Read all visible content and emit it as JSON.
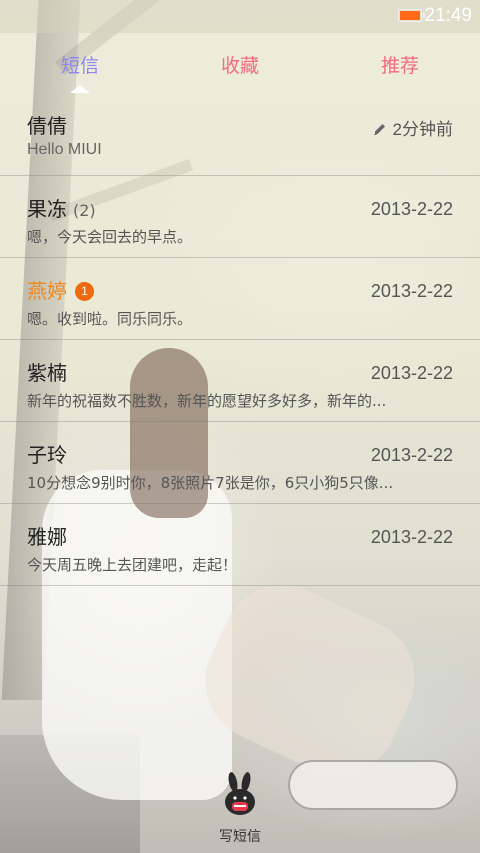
{
  "status_bar": {
    "time": "21:49",
    "battery_color": "#ff6a1a"
  },
  "tabs": [
    {
      "label": "短信",
      "selected": true,
      "color": "#8b86f0"
    },
    {
      "label": "收藏",
      "selected": false,
      "color": "#f46a7e"
    },
    {
      "label": "推荐",
      "selected": false,
      "color": "#f46a7e"
    }
  ],
  "threads": [
    {
      "name": "倩倩",
      "preview": "Hello MIUI",
      "time": "2分钟前",
      "icon": "pencil-icon",
      "count": "",
      "unread_badge": ""
    },
    {
      "name": "果冻",
      "count": "(2)",
      "preview": "嗯，今天会回去的早点。",
      "time": "2013-2-22",
      "unread_badge": ""
    },
    {
      "name": "燕婷",
      "count": "",
      "unread_badge": "1",
      "preview": "嗯。收到啦。同乐同乐。",
      "time": "2013-2-22"
    },
    {
      "name": "紫楠",
      "count": "",
      "unread_badge": "",
      "preview": "新年的祝福数不胜数，新年的愿望好多好多，新年的...",
      "time": "2013-2-22"
    },
    {
      "name": "子玲",
      "count": "",
      "unread_badge": "",
      "preview": "10分想念9别时你，8张照片7张是你，6只小狗5只像...",
      "time": "2013-2-22"
    },
    {
      "name": "雅娜",
      "count": "",
      "unread_badge": "",
      "preview": "今天周五晚上去团建吧，走起！",
      "time": "2013-2-22"
    }
  ],
  "compose": {
    "label": "写短信",
    "icon": "bunny-compose-icon"
  },
  "colors": {
    "unread_name": "#f0861e",
    "badge": "#ef6a0e"
  }
}
